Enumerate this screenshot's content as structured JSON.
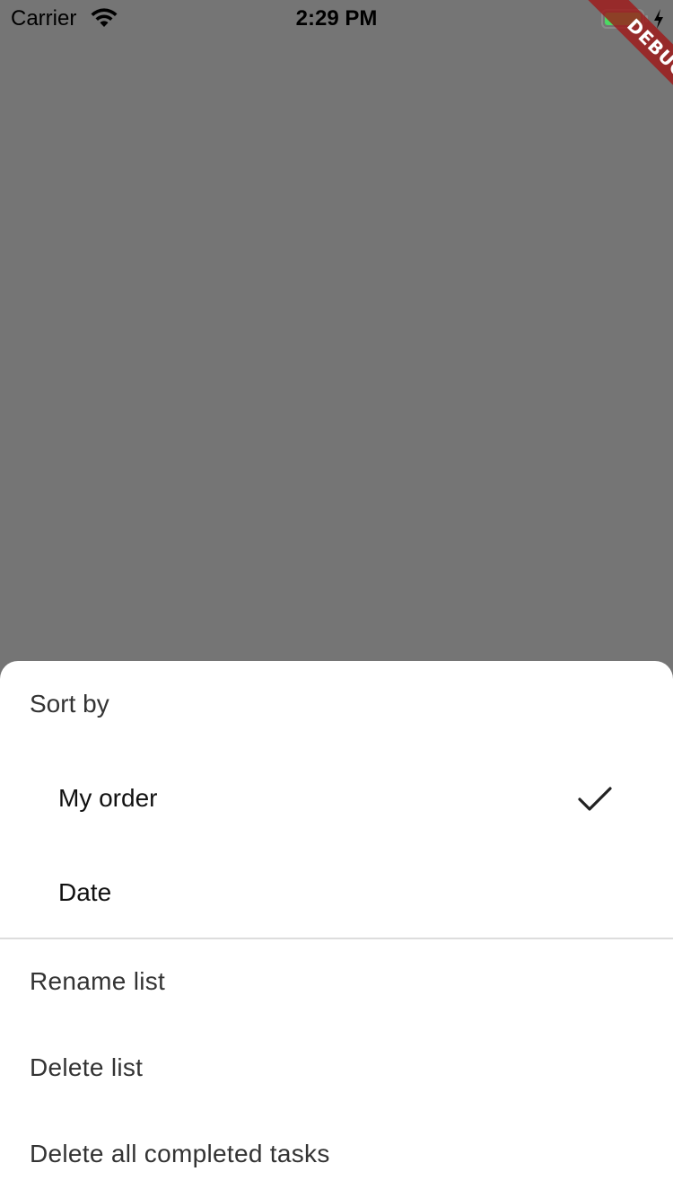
{
  "status_bar": {
    "carrier": "Carrier",
    "time": "2:29 PM",
    "wifi_icon": "wifi-icon",
    "battery_icon": "battery-charging-icon",
    "battery_color": "#4cd964"
  },
  "debug_banner": {
    "label": "DEBUG",
    "color": "#a01414"
  },
  "sheet": {
    "sort_title": "Sort by",
    "sort_options": [
      {
        "label": "My order",
        "selected": true,
        "icon": "check-icon"
      },
      {
        "label": "Date",
        "selected": false
      }
    ],
    "actions": [
      {
        "label": "Rename list"
      },
      {
        "label": "Delete list"
      },
      {
        "label": "Delete all completed tasks"
      }
    ]
  }
}
